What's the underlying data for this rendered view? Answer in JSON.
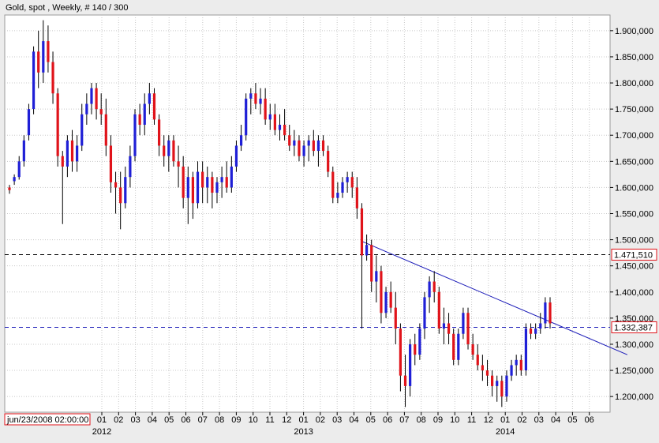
{
  "header": {
    "title": "Gold, spot , Weekly, # 140 / 300"
  },
  "cursor": {
    "date_label": "jun/23/2008 02:00:00"
  },
  "colors": {
    "background": "#ffffff",
    "frame": "#ececec",
    "grid": "#c8c8c8",
    "bull": "#1f1fd6",
    "bear": "#e0131a",
    "wick": "#000000",
    "trendline": "#1b1bb8",
    "hline_black": "#000000",
    "hline_blue": "#1b1bb8",
    "price_box_border": "#e0131a"
  },
  "chart_data": {
    "type": "candlestick",
    "title": "Gold, spot , Weekly, # 140 / 300",
    "ylim": [
      1170,
      1930
    ],
    "y_ticks": [
      1200,
      1250,
      1300,
      1350,
      1400,
      1450,
      1500,
      1550,
      1600,
      1650,
      1700,
      1750,
      1800,
      1850,
      1900
    ],
    "y_tick_labels": [
      "1.200,000",
      "1.250,000",
      "1.300,000",
      "1.350,000",
      "1.400,000",
      "1.450,000",
      "1.500,000",
      "1.550,000",
      "1.600,000",
      "1.650,000",
      "1.700,000",
      "1.750,000",
      "1.800,000",
      "1.850,000",
      "1.900,000"
    ],
    "x_month_labels": [
      "01",
      "02",
      "03",
      "04",
      "05",
      "06",
      "07",
      "08",
      "09",
      "10",
      "11",
      "12",
      "01",
      "02",
      "03",
      "04",
      "05",
      "06",
      "07",
      "08",
      "09",
      "10",
      "11",
      "12",
      "01",
      "02",
      "03",
      "04",
      "05",
      "06"
    ],
    "x_year_labels": [
      {
        "label": "2012",
        "month_index": 0
      },
      {
        "label": "2013",
        "month_index": 12
      },
      {
        "label": "2014",
        "month_index": 24
      }
    ],
    "grid": true,
    "candles": [
      [
        1600,
        1605,
        1588,
        1595
      ],
      [
        1612,
        1625,
        1605,
        1620
      ],
      [
        1620,
        1660,
        1615,
        1650
      ],
      [
        1650,
        1700,
        1640,
        1690
      ],
      [
        1700,
        1760,
        1690,
        1750
      ],
      [
        1750,
        1870,
        1740,
        1860
      ],
      [
        1860,
        1900,
        1790,
        1820
      ],
      [
        1820,
        1920,
        1800,
        1880
      ],
      [
        1880,
        1910,
        1820,
        1840
      ],
      [
        1840,
        1860,
        1760,
        1780
      ],
      [
        1780,
        1790,
        1640,
        1660
      ],
      [
        1660,
        1670,
        1530,
        1640
      ],
      [
        1640,
        1700,
        1620,
        1690
      ],
      [
        1690,
        1710,
        1630,
        1650
      ],
      [
        1650,
        1700,
        1630,
        1680
      ],
      [
        1680,
        1760,
        1670,
        1740
      ],
      [
        1740,
        1780,
        1720,
        1760
      ],
      [
        1760,
        1800,
        1740,
        1790
      ],
      [
        1790,
        1800,
        1730,
        1750
      ],
      [
        1750,
        1780,
        1720,
        1740
      ],
      [
        1740,
        1770,
        1660,
        1680
      ],
      [
        1680,
        1700,
        1590,
        1610
      ],
      [
        1610,
        1630,
        1550,
        1600
      ],
      [
        1600,
        1630,
        1520,
        1570
      ],
      [
        1570,
        1640,
        1560,
        1620
      ],
      [
        1620,
        1680,
        1600,
        1660
      ],
      [
        1660,
        1750,
        1650,
        1740
      ],
      [
        1740,
        1760,
        1700,
        1720
      ],
      [
        1720,
        1780,
        1700,
        1760
      ],
      [
        1760,
        1800,
        1740,
        1780
      ],
      [
        1780,
        1790,
        1720,
        1730
      ],
      [
        1730,
        1740,
        1660,
        1680
      ],
      [
        1680,
        1700,
        1640,
        1660
      ],
      [
        1660,
        1700,
        1630,
        1690
      ],
      [
        1690,
        1700,
        1640,
        1650
      ],
      [
        1650,
        1680,
        1600,
        1640
      ],
      [
        1640,
        1660,
        1560,
        1580
      ],
      [
        1580,
        1640,
        1530,
        1620
      ],
      [
        1620,
        1630,
        1540,
        1570
      ],
      [
        1570,
        1650,
        1560,
        1630
      ],
      [
        1630,
        1650,
        1570,
        1600
      ],
      [
        1600,
        1640,
        1570,
        1620
      ],
      [
        1620,
        1630,
        1560,
        1590
      ],
      [
        1590,
        1620,
        1570,
        1610
      ],
      [
        1610,
        1640,
        1580,
        1620
      ],
      [
        1620,
        1650,
        1590,
        1600
      ],
      [
        1600,
        1660,
        1590,
        1640
      ],
      [
        1640,
        1690,
        1630,
        1680
      ],
      [
        1680,
        1720,
        1670,
        1700
      ],
      [
        1700,
        1780,
        1690,
        1770
      ],
      [
        1770,
        1790,
        1740,
        1780
      ],
      [
        1780,
        1800,
        1750,
        1760
      ],
      [
        1760,
        1790,
        1740,
        1770
      ],
      [
        1770,
        1790,
        1720,
        1730
      ],
      [
        1730,
        1760,
        1710,
        1740
      ],
      [
        1740,
        1760,
        1700,
        1710
      ],
      [
        1710,
        1740,
        1690,
        1720
      ],
      [
        1720,
        1750,
        1690,
        1700
      ],
      [
        1700,
        1720,
        1670,
        1680
      ],
      [
        1680,
        1710,
        1660,
        1690
      ],
      [
        1690,
        1700,
        1650,
        1660
      ],
      [
        1660,
        1690,
        1640,
        1680
      ],
      [
        1680,
        1700,
        1650,
        1690
      ],
      [
        1690,
        1710,
        1660,
        1670
      ],
      [
        1670,
        1700,
        1640,
        1690
      ],
      [
        1690,
        1700,
        1660,
        1670
      ],
      [
        1670,
        1680,
        1620,
        1630
      ],
      [
        1630,
        1640,
        1570,
        1580
      ],
      [
        1580,
        1610,
        1570,
        1590
      ],
      [
        1590,
        1620,
        1580,
        1610
      ],
      [
        1610,
        1630,
        1590,
        1620
      ],
      [
        1620,
        1630,
        1580,
        1600
      ],
      [
        1600,
        1620,
        1540,
        1560
      ],
      [
        1560,
        1570,
        1330,
        1470
      ],
      [
        1470,
        1510,
        1460,
        1490
      ],
      [
        1490,
        1500,
        1400,
        1420
      ],
      [
        1420,
        1470,
        1380,
        1440
      ],
      [
        1440,
        1450,
        1340,
        1360
      ],
      [
        1360,
        1410,
        1350,
        1400
      ],
      [
        1400,
        1420,
        1360,
        1370
      ],
      [
        1370,
        1400,
        1300,
        1330
      ],
      [
        1330,
        1340,
        1210,
        1240
      ],
      [
        1240,
        1280,
        1180,
        1220
      ],
      [
        1220,
        1310,
        1200,
        1300
      ],
      [
        1300,
        1320,
        1260,
        1280
      ],
      [
        1280,
        1340,
        1270,
        1330
      ],
      [
        1330,
        1400,
        1310,
        1390
      ],
      [
        1390,
        1430,
        1360,
        1420
      ],
      [
        1420,
        1440,
        1380,
        1400
      ],
      [
        1400,
        1410,
        1320,
        1330
      ],
      [
        1330,
        1370,
        1300,
        1340
      ],
      [
        1340,
        1360,
        1300,
        1320
      ],
      [
        1320,
        1330,
        1260,
        1270
      ],
      [
        1270,
        1330,
        1260,
        1320
      ],
      [
        1320,
        1370,
        1310,
        1360
      ],
      [
        1360,
        1370,
        1290,
        1300
      ],
      [
        1300,
        1320,
        1270,
        1280
      ],
      [
        1280,
        1300,
        1250,
        1260
      ],
      [
        1260,
        1280,
        1230,
        1250
      ],
      [
        1250,
        1270,
        1220,
        1240
      ],
      [
        1240,
        1250,
        1200,
        1220
      ],
      [
        1220,
        1240,
        1190,
        1230
      ],
      [
        1230,
        1240,
        1180,
        1200
      ],
      [
        1200,
        1250,
        1190,
        1240
      ],
      [
        1240,
        1270,
        1230,
        1260
      ],
      [
        1260,
        1280,
        1240,
        1270
      ],
      [
        1270,
        1280,
        1240,
        1250
      ],
      [
        1250,
        1340,
        1240,
        1330
      ],
      [
        1330,
        1340,
        1310,
        1320
      ],
      [
        1320,
        1340,
        1310,
        1330
      ],
      [
        1330,
        1360,
        1320,
        1340
      ],
      [
        1340,
        1390,
        1330,
        1380
      ],
      [
        1380,
        1390,
        1330,
        1340
      ]
    ],
    "trendline": {
      "from_index": 73,
      "from_price": 1497,
      "to_index": 128,
      "to_price": 1280
    },
    "hlines": [
      {
        "price": 1471.51,
        "label": "1.471,510",
        "color": "#000000"
      },
      {
        "price": 1332.387,
        "label": "1.332,387",
        "color": "#1b1bb8"
      }
    ]
  }
}
